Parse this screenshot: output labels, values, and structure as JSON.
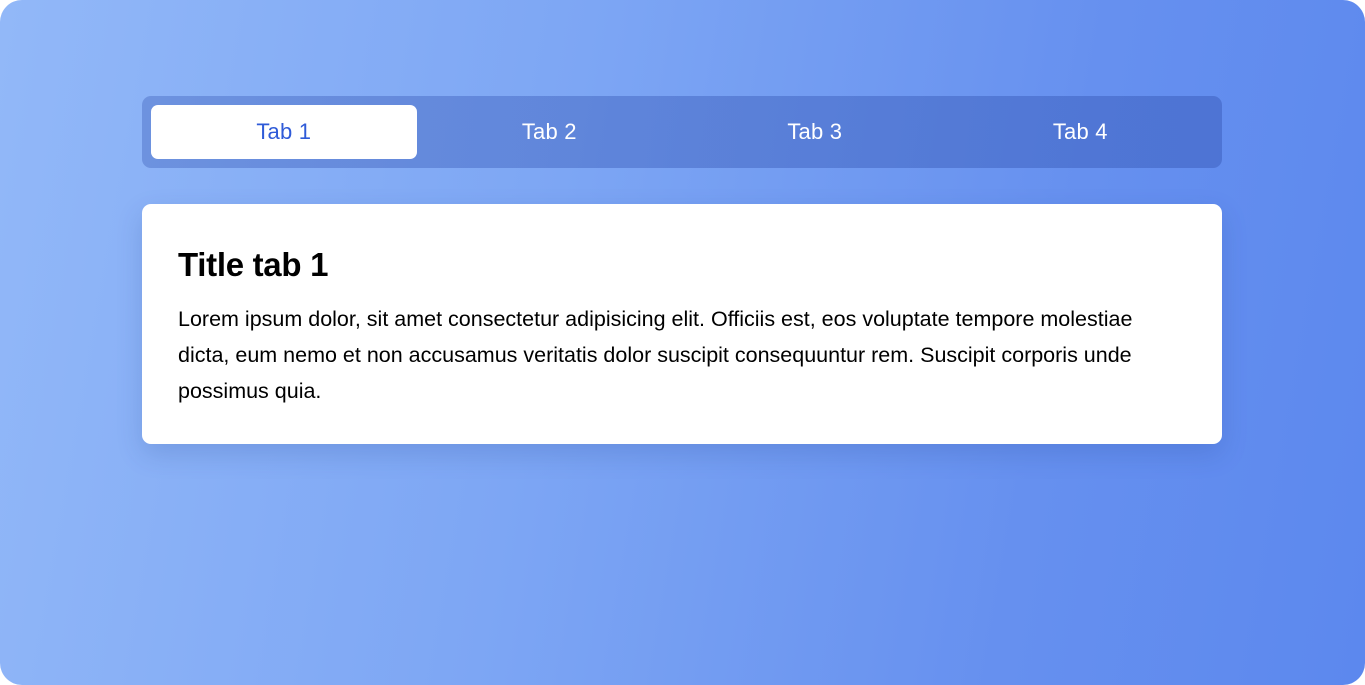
{
  "tabs": [
    {
      "label": "Tab 1",
      "active": true
    },
    {
      "label": "Tab 2",
      "active": false
    },
    {
      "label": "Tab 3",
      "active": false
    },
    {
      "label": "Tab 4",
      "active": false
    }
  ],
  "content": {
    "title": "Title tab 1",
    "body": "Lorem ipsum dolor, sit amet consectetur adipisicing elit. Officiis est, eos voluptate tempore molestiae dicta, eum nemo et non accusamus veritatis dolor suscipit consequuntur rem. Suscipit corporis unde possimus quia."
  },
  "colors": {
    "active_tab_text": "#2f5bd8",
    "inactive_tab_text": "#ffffff",
    "background_gradient_start": "#92b8f8",
    "background_gradient_end": "#5c88ee"
  }
}
